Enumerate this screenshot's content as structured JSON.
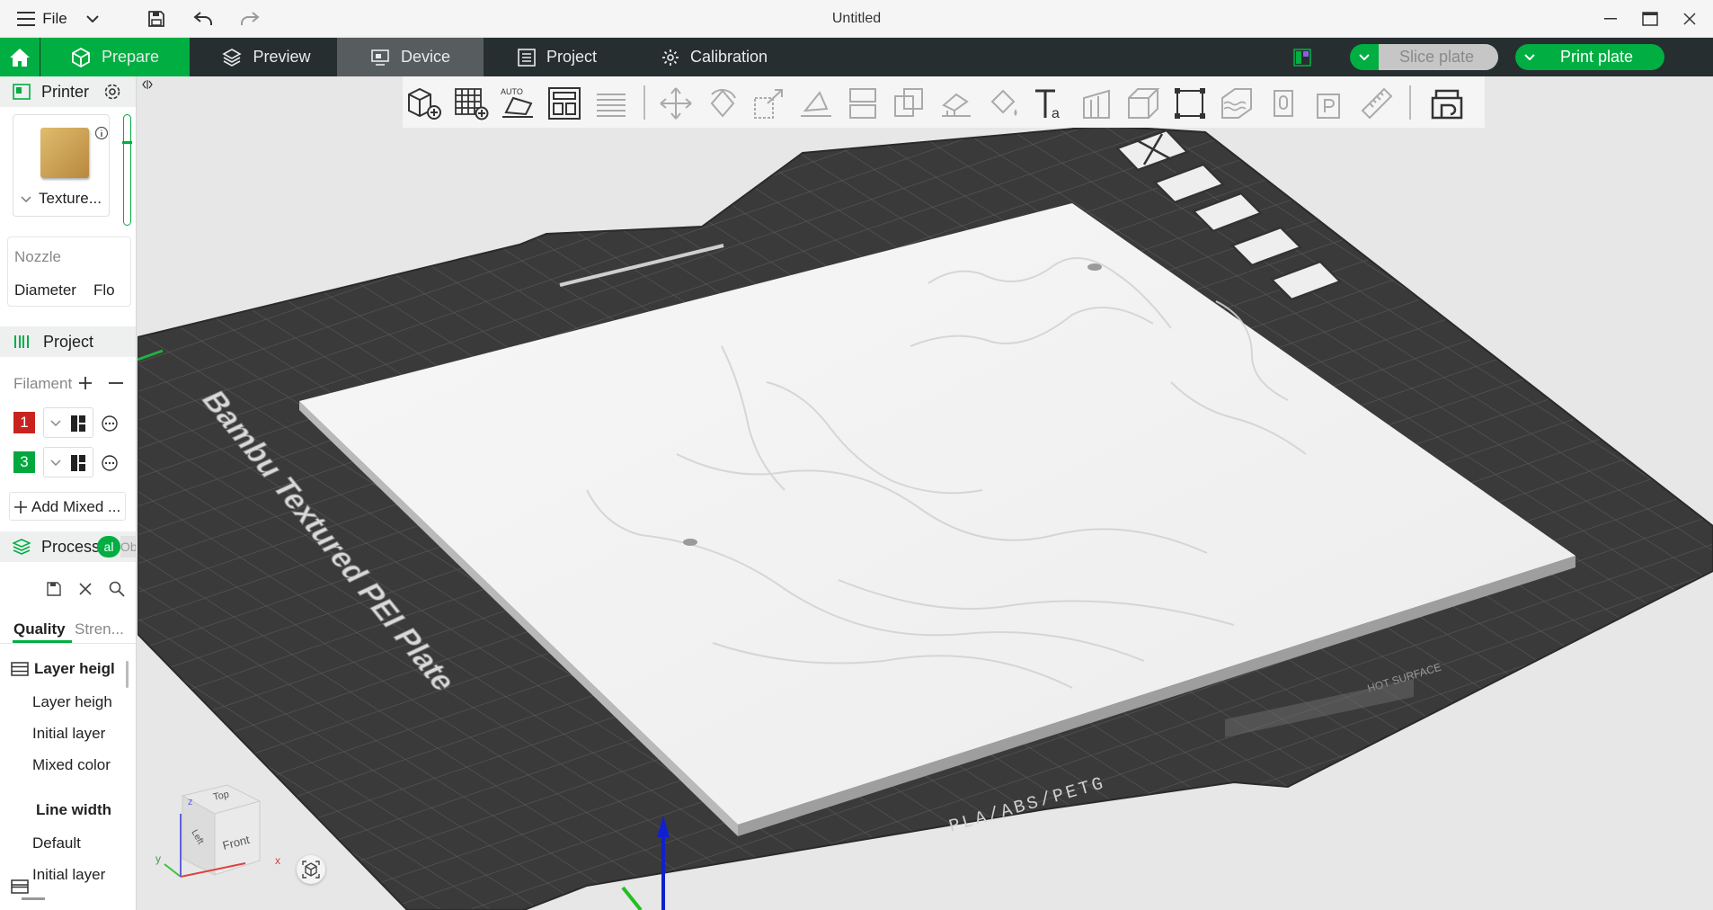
{
  "titlebar": {
    "menu_label": "File",
    "title": "Untitled"
  },
  "tabs": {
    "prepare": "Prepare",
    "preview": "Preview",
    "device": "Device",
    "project": "Project",
    "calibration": "Calibration"
  },
  "actions": {
    "slice": "Slice plate",
    "print": "Print plate"
  },
  "printer": {
    "header": "Printer",
    "plate_label": "Texture...",
    "nozzle_title": "Nozzle",
    "diameter_label": "Diameter",
    "flow_label": "Flo"
  },
  "project": {
    "header": "Project",
    "filament_label": "Filament",
    "filaments": [
      {
        "num": "1",
        "color": "#c8231e"
      },
      {
        "num": "3",
        "color": "#00a83e"
      }
    ],
    "add_mixed": "Add Mixed ..."
  },
  "process": {
    "header": "Process",
    "toggle_on": "al",
    "toggle_off": "Ob",
    "tab_quality": "Quality",
    "tab_strength": "Stren...",
    "group1": "Layer heigl",
    "group1_items": [
      "Layer heigh",
      "Initial layer",
      "Mixed color"
    ],
    "group2": "Line width",
    "group2_items": [
      "Default",
      "Initial layer"
    ]
  },
  "viewcube": {
    "top": "Top",
    "front": "Front",
    "left": "Left",
    "axis_x": "x",
    "axis_y": "y",
    "axis_z": "z"
  },
  "plate": {
    "bed_label": "Bambu Textured PEI Plate",
    "material_label": "PLA/ABS/PETG",
    "hot_label": "HOT SURFACE"
  },
  "colors": {
    "accent": "#00ae42",
    "tabbar": "#262e30",
    "bed": "#3c3c3c",
    "model": "#f1f1f1"
  }
}
